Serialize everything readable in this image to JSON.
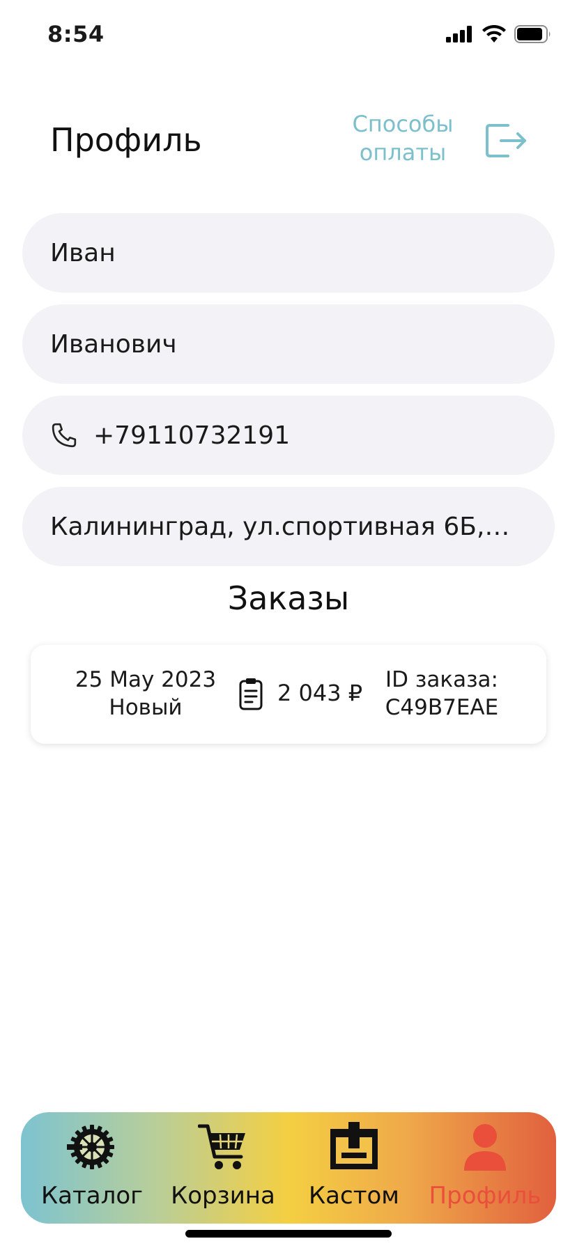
{
  "status": {
    "time": "8:54"
  },
  "header": {
    "title": "Профиль",
    "payment_methods": "Способы оплаты",
    "payment_line1": "Способы",
    "payment_line2": "оплаты"
  },
  "profile": {
    "first_name": "Иван",
    "patronymic": "Иванович",
    "phone": "+79110732191",
    "address": "Калининград, ул.спортивная 6Б, 2..."
  },
  "orders": {
    "title": "Заказы",
    "items": [
      {
        "date": "25 May 2023",
        "status": "Новый",
        "total": "2 043 ₽",
        "id_label": "ID заказа:",
        "id": "C49B7EAE"
      }
    ]
  },
  "tabbar": {
    "items": [
      {
        "label": "Каталог",
        "icon": "bicycle-gear-icon"
      },
      {
        "label": "Корзина",
        "icon": "cart-icon"
      },
      {
        "label": "Кастом",
        "icon": "box-icon"
      },
      {
        "label": "Профиль",
        "icon": "person-icon"
      }
    ],
    "active_color": "#e94f3b"
  },
  "colors": {
    "accent": "#7cc0cc",
    "field_bg": "#f3f3f7"
  }
}
